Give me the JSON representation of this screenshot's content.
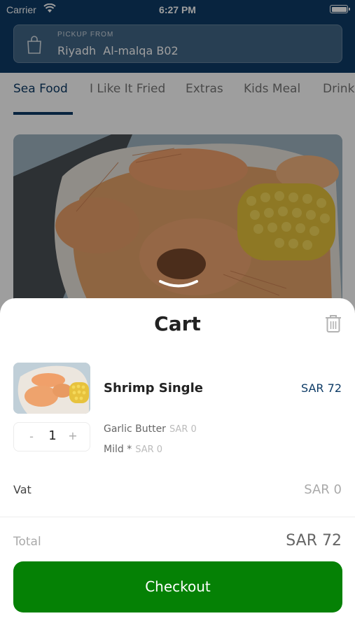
{
  "status_bar": {
    "carrier": "Carrier",
    "time": "6:27 PM"
  },
  "pickup": {
    "label": "PICKUP FROM",
    "location": "Riyadh  Al-malqa B02",
    "icon": "shopping-bag-icon"
  },
  "tabs": [
    {
      "label": "Sea Food",
      "active": true
    },
    {
      "label": "I Like It Fried",
      "active": false
    },
    {
      "label": "Extras",
      "active": false
    },
    {
      "label": "Kids Meal",
      "active": false
    },
    {
      "label": "Drinks",
      "active": false
    }
  ],
  "cart": {
    "title": "Cart",
    "item": {
      "name": "Shrimp Single",
      "price": "SAR 72",
      "quantity": "1",
      "decrement": "-",
      "increment": "+",
      "modifiers": [
        {
          "name": "Garlic Butter",
          "price": "SAR 0"
        },
        {
          "name": "Mild *",
          "price": "SAR 0"
        }
      ]
    },
    "vat": {
      "label": "Vat",
      "value": "SAR 0"
    },
    "total": {
      "label": "Total",
      "value": "SAR 72"
    },
    "checkout_label": "Checkout"
  },
  "colors": {
    "brand": "#0d3b66",
    "checkout": "#058105"
  }
}
